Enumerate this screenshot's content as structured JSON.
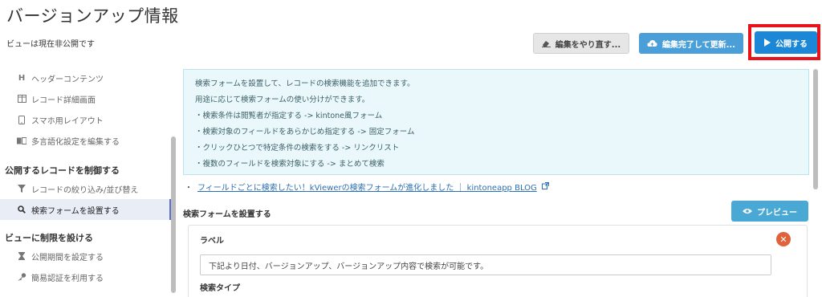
{
  "page": {
    "title": "バージョンアップ情報",
    "status": "ビューは現在非公開です"
  },
  "toolbar": {
    "redo_label": "編集をやり直す...",
    "finish_label": "編集完了して更新...",
    "publish_label": "公開する"
  },
  "sidebar": {
    "items": [
      {
        "label": "ヘッダーコンテンツ",
        "icon": "header-icon"
      },
      {
        "label": "レコード詳細画面",
        "icon": "columns-icon"
      },
      {
        "label": "スマホ用レイアウト",
        "icon": "mobile-icon"
      },
      {
        "label": "多言語化設定を編集する",
        "icon": "language-icon"
      }
    ],
    "section_records": "公開するレコードを制御する",
    "record_items": [
      {
        "label": "レコードの絞り込み/並び替え",
        "icon": "filter-icon"
      },
      {
        "label": "検索フォームを設置する",
        "icon": "search-icon",
        "active": true
      }
    ],
    "section_limits": "ビューに制限を設ける",
    "limit_items": [
      {
        "label": "公開期間を設定する",
        "icon": "hourglass-icon"
      },
      {
        "label": "簡易認証を利用する",
        "icon": "key-icon"
      }
    ]
  },
  "info": {
    "lines": [
      "検索フォームを設置して、レコードの検索機能を追加できます。",
      "用途に応じて検索フォームの使い分けができます。",
      "・検索条件は閲覧者が指定する -> kintone風フォーム",
      "・検索対象のフィールドをあらかじめ指定する -> 固定フォーム",
      "・クリックひとつで特定条件の検索をする -> リンクリスト",
      "・複数のフィールドを検索対象にする -> まとめて検索"
    ]
  },
  "link": {
    "bullet": "・",
    "text": "フィールドごとに検索したい！kViewerの検索フォームが進化しました ｜ kintoneapp BLOG"
  },
  "form_section": {
    "title": "検索フォームを設置する",
    "preview_label": "プレビュー",
    "label_heading": "ラベル",
    "label_value": "下記より日付、バージョンアップ、バージョンアップ内容で検索が可能です。",
    "type_heading": "検索タイプ"
  },
  "colors": {
    "primary": "#1c87d6",
    "highlight": "#e8141c",
    "info_bg": "#eaf8fb",
    "danger": "#e0623a"
  }
}
